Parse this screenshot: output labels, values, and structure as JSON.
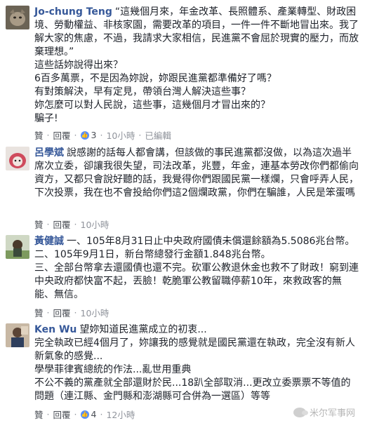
{
  "comments": [
    {
      "name": "Jo-chung Teng",
      "text": "“這幾個月來，年金改革、長照體系、產業轉型、財政困境、勞動權益、非核家園，需要改革的項目，一件一件不斷地冒出來。我了解大家的焦慮，不過，我請求大家相信，民進黨不會屈於現實的壓力，而放棄理想。”\n這些話妳說得出來？\n6百多萬票，不是因為妳說，妳跟民進黨都準備好了嗎？\n有對策解決，早有定見，帶領台灣人解決這些事？\n妳怎麼可以對人民說，這些事，這幾個月才冒出來的？\n騙子!",
      "actions": {
        "like": "贊",
        "reply": "回覆",
        "likes": "3",
        "time": "10小時",
        "edited": "已編輯"
      }
    },
    {
      "name": "呂學斌",
      "text": "說感謝的話每人都會講，但該做的事民進黨都沒做，以為這次過半席次立委，卻讓我很失望，司法改革，兆豐，年金，連基本勞改你們都偷向資方，又都只會說好聽的話，我覺得你們跟國民黨一樣爛，只會呼弄人民，下次投票，我在也不會投給你們這2個爛政黨，你們在騙誰，人民是笨蛋嗎",
      "actions": {
        "like": "贊",
        "reply": "回覆",
        "time": "10小時"
      }
    },
    {
      "name": "黃健誠",
      "text": "一、105年8月31日止中央政府國債未償還餘額為5.5086兆台幣。\n二、105年9月1日，新台幣總發行金額1.848兆台幣。\n三、全部台幣拿去還國債也還不完。砍軍公教退休金也救不了財政！窮到連中央政府都快富不起，丟臉！乾脆軍公教留職停薪10年，來救政客的無能、無信。",
      "actions": {
        "like": "贊",
        "reply": "回覆",
        "time": "10小時"
      }
    },
    {
      "name": "Ken Wu",
      "text": "望妳知道民進黨成立的初衷...\n完全執政已經4個月了，妳讓我的感覺就是國民黨還在執政，完全沒有新人新氣象的感覺...\n學學菲律賓總統的作法...亂世用重典\n不公不義的黨產就全部還財於民...18趴全部取消...更改立委票票不等值的問題（連江縣、金門縣和澎湖縣可合併為一選區）等等",
      "actions": {
        "like": "贊",
        "reply": "回覆",
        "likes": "4",
        "time": "12小時"
      }
    }
  ],
  "watermark": "米尔军事网",
  "colors": {
    "name": "#365899",
    "meta": "#90949c",
    "like_badge": "#5890ff"
  }
}
